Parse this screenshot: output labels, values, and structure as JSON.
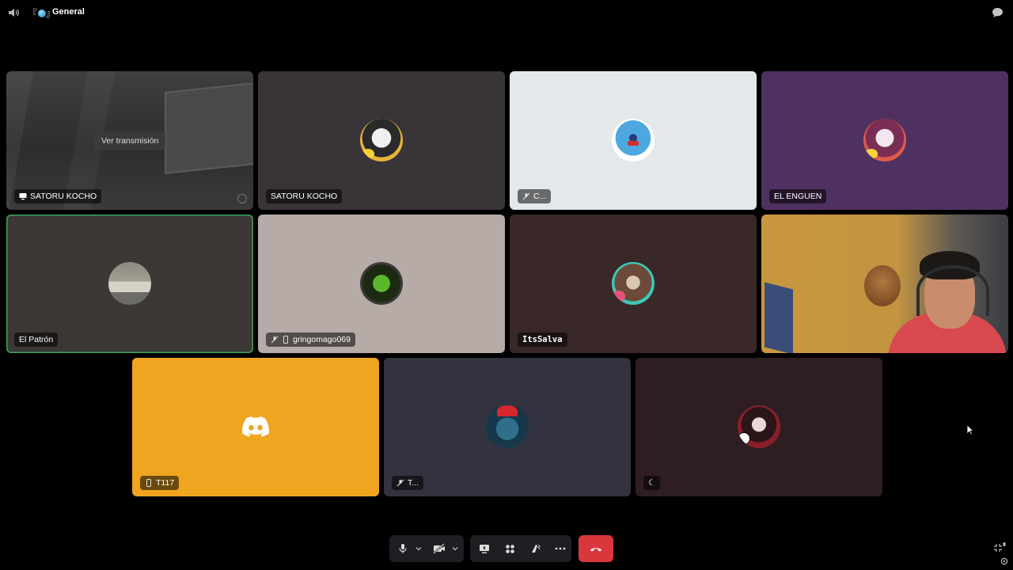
{
  "topbar": {
    "channel_emoji": "『",
    "channel_emoji_end": "』",
    "channel_name": "General"
  },
  "tiles": [
    {
      "name": "SATORU KOCHO",
      "stream_button": "Ver transmisión",
      "kind": "stream",
      "bg": "#3a3a3a"
    },
    {
      "name": "SATORU KOCHO",
      "kind": "avatar",
      "bg": "#383438",
      "ring": "#e8b33a"
    },
    {
      "name": "C...",
      "kind": "avatar",
      "bg": "#e4e8ea",
      "muted": true
    },
    {
      "name": "EL ENGUEN",
      "kind": "avatar",
      "bg": "#4f3161",
      "ring": "#e05a4a"
    },
    {
      "name": "El Patrón",
      "kind": "avatar",
      "bg": "#3c3836",
      "speaking": true
    },
    {
      "name": "gringomago069",
      "kind": "avatar",
      "bg": "#b7aba7",
      "muted": true,
      "mobile": true
    },
    {
      "name": "ItsSalva",
      "kind": "avatar",
      "bg": "#3a2828",
      "ring": "#3fc7b8"
    },
    {
      "name": "",
      "kind": "camera"
    },
    {
      "name": "T117",
      "kind": "discord",
      "bg": "#f0a521",
      "mobile": true
    },
    {
      "name": "T...",
      "kind": "avatar",
      "bg": "#33323f",
      "muted": true
    },
    {
      "name": "☾",
      "kind": "avatar",
      "bg": "#2e1e22"
    }
  ],
  "controls": {
    "mic": "microphone-icon",
    "camera": "camera-off-icon",
    "share": "screen-share-icon",
    "activities": "activities-icon",
    "soundboard": "soundboard-icon",
    "more": "more-icon",
    "disconnect": "hang-up-icon",
    "disconnect_color": "#da373c"
  }
}
